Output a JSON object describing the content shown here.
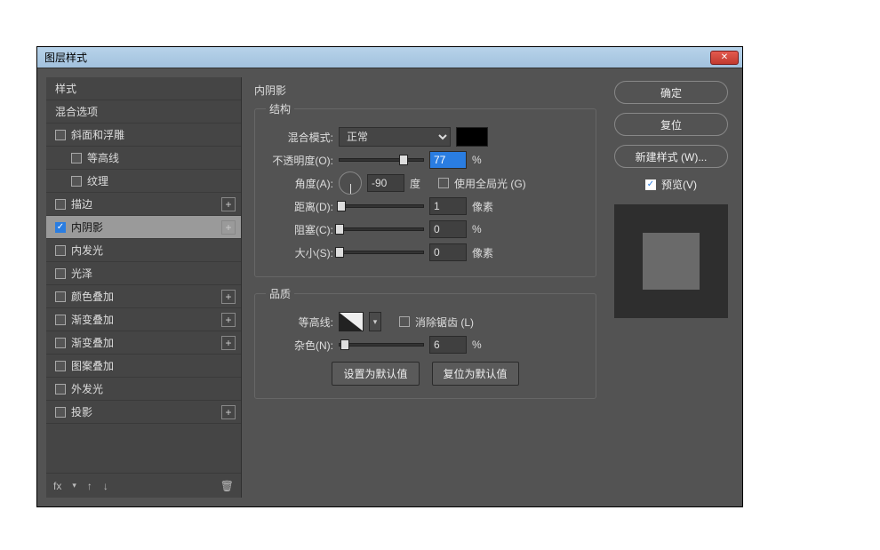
{
  "window": {
    "title": "图层样式"
  },
  "sidebar": {
    "header_styles": "样式",
    "header_blend": "混合选项",
    "items": [
      {
        "label": "斜面和浮雕",
        "checked": false,
        "plus": false,
        "indent": false
      },
      {
        "label": "等高线",
        "checked": false,
        "plus": false,
        "indent": true
      },
      {
        "label": "纹理",
        "checked": false,
        "plus": false,
        "indent": true
      },
      {
        "label": "描边",
        "checked": false,
        "plus": true,
        "indent": false
      },
      {
        "label": "内阴影",
        "checked": true,
        "plus": true,
        "indent": false,
        "selected": true
      },
      {
        "label": "内发光",
        "checked": false,
        "plus": false,
        "indent": false
      },
      {
        "label": "光泽",
        "checked": false,
        "plus": false,
        "indent": false
      },
      {
        "label": "颜色叠加",
        "checked": false,
        "plus": true,
        "indent": false
      },
      {
        "label": "渐变叠加",
        "checked": false,
        "plus": true,
        "indent": false
      },
      {
        "label": "渐变叠加",
        "checked": false,
        "plus": true,
        "indent": false
      },
      {
        "label": "图案叠加",
        "checked": false,
        "plus": false,
        "indent": false
      },
      {
        "label": "外发光",
        "checked": false,
        "plus": false,
        "indent": false
      },
      {
        "label": "投影",
        "checked": false,
        "plus": true,
        "indent": false
      }
    ],
    "footer": {
      "fx": "fx",
      "up": "↑",
      "down": "↓",
      "trash": "🗑"
    }
  },
  "main": {
    "title": "内阴影",
    "group_structure": "结构",
    "blend_mode_label": "混合模式:",
    "blend_mode_value": "正常",
    "opacity_label": "不透明度(O):",
    "opacity_value": "77",
    "opacity_unit": "%",
    "angle_label": "角度(A):",
    "angle_value": "-90",
    "angle_unit": "度",
    "global_light_label": "使用全局光 (G)",
    "distance_label": "距离(D):",
    "distance_value": "1",
    "distance_unit": "像素",
    "choke_label": "阻塞(C):",
    "choke_value": "0",
    "choke_unit": "%",
    "size_label": "大小(S):",
    "size_value": "0",
    "size_unit": "像素",
    "group_quality": "品质",
    "contour_label": "等高线:",
    "antialias_label": "消除锯齿 (L)",
    "noise_label": "杂色(N):",
    "noise_value": "6",
    "noise_unit": "%",
    "btn_default": "设置为默认值",
    "btn_reset": "复位为默认值"
  },
  "right": {
    "ok": "确定",
    "reset": "复位",
    "new_style": "新建样式 (W)...",
    "preview": "预览(V)"
  }
}
